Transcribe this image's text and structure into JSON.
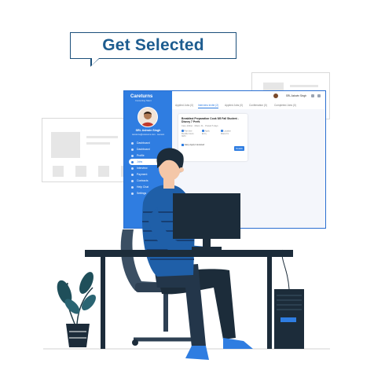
{
  "headline": "Get Selected",
  "app": {
    "logo": "Careturns",
    "logo_tag": "Connecting Talent",
    "user_name": "SRL Ashwin Singh",
    "user_sub": "careturns@careturns.com · tsunami",
    "top_user": "SRL Ashwin Singh",
    "nav": [
      {
        "label": "Dashboard"
      },
      {
        "label": "Dashboard"
      },
      {
        "label": "Profile"
      },
      {
        "label": "Jobs"
      },
      {
        "label": "Interview"
      },
      {
        "label": "Payment"
      },
      {
        "label": "Contracts"
      },
      {
        "label": "Help Chat"
      },
      {
        "label": "Settings"
      }
    ],
    "tabs": [
      {
        "label": "Applied Jobs (0)"
      },
      {
        "label": "Interview Invite (2)"
      },
      {
        "label": "Applied Jobs (0)"
      },
      {
        "label": "Confirmation (0)"
      },
      {
        "label": "Completed Jobs (0)"
      }
    ],
    "job": {
      "title": "Breakfast Preparation Cook 5/8 Fall Student - Disney 7 Prefs",
      "meta": "Care Jobber · Miami, FL · Posted 5 days",
      "col1": [
        "Part time",
        "Flexible hours",
        "30/hr"
      ],
      "col2": [
        "Apply",
        "Entry"
      ],
      "col3": [
        "Location",
        "Miami FL"
      ],
      "check": "Easy Apply Interested",
      "button": "Details"
    }
  },
  "colors": {
    "brand_blue": "#2f7de1",
    "headline_blue": "#1d5c8f",
    "shirt_blue": "#1f5fa8",
    "dark_navy": "#1c2c3a"
  }
}
